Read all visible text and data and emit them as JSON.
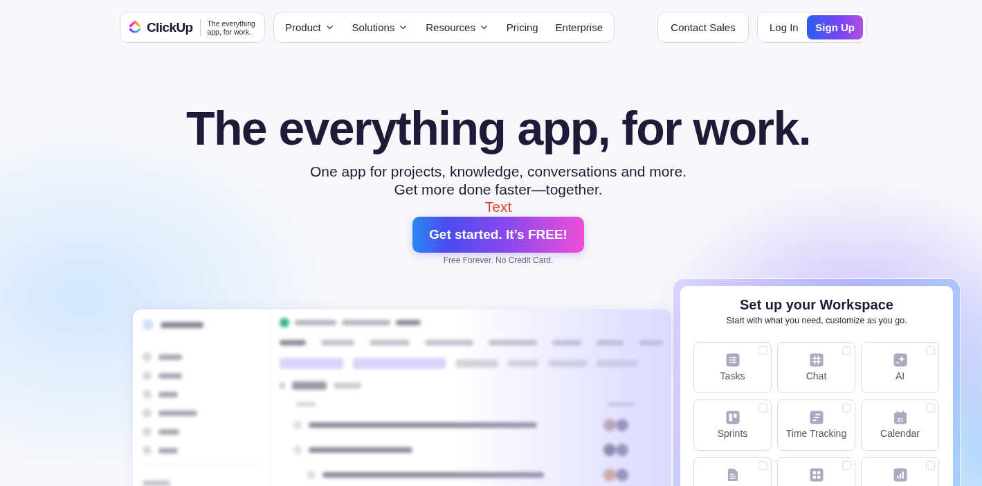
{
  "nav": {
    "logo": {
      "brand": "ClickUp",
      "tagline": "The everything app, for work."
    },
    "links": [
      {
        "label": "Product",
        "has_menu": true
      },
      {
        "label": "Solutions",
        "has_menu": true
      },
      {
        "label": "Resources",
        "has_menu": true
      },
      {
        "label": "Pricing",
        "has_menu": false
      },
      {
        "label": "Enterprise",
        "has_menu": false
      }
    ],
    "contact_button": "Contact Sales",
    "login_link": "Log In",
    "signup_button": "Sign Up"
  },
  "hero": {
    "title": "The everything app, for work.",
    "subtitle_lines": [
      "One app for projects, knowledge, conversations and more.",
      "Get more done faster—together."
    ],
    "overlay_label": "Text",
    "cta_button": "Get started. It’s FREE!",
    "cta_note": "Free Forever. No Credit Card."
  },
  "workspace_setup": {
    "title": "Set up your Workspace",
    "subtitle": "Start with what you need, customize as you go.",
    "options": [
      {
        "label": "Tasks",
        "checked": false
      },
      {
        "label": "Chat",
        "checked": false
      },
      {
        "label": "AI",
        "checked": false
      },
      {
        "label": "Sprints",
        "checked": false
      },
      {
        "label": "Time Tracking",
        "checked": false
      },
      {
        "label": "Calendar",
        "checked": false,
        "icon_text": "31"
      },
      {
        "checked": false
      },
      {
        "checked": false
      },
      {
        "checked": false
      }
    ]
  }
}
